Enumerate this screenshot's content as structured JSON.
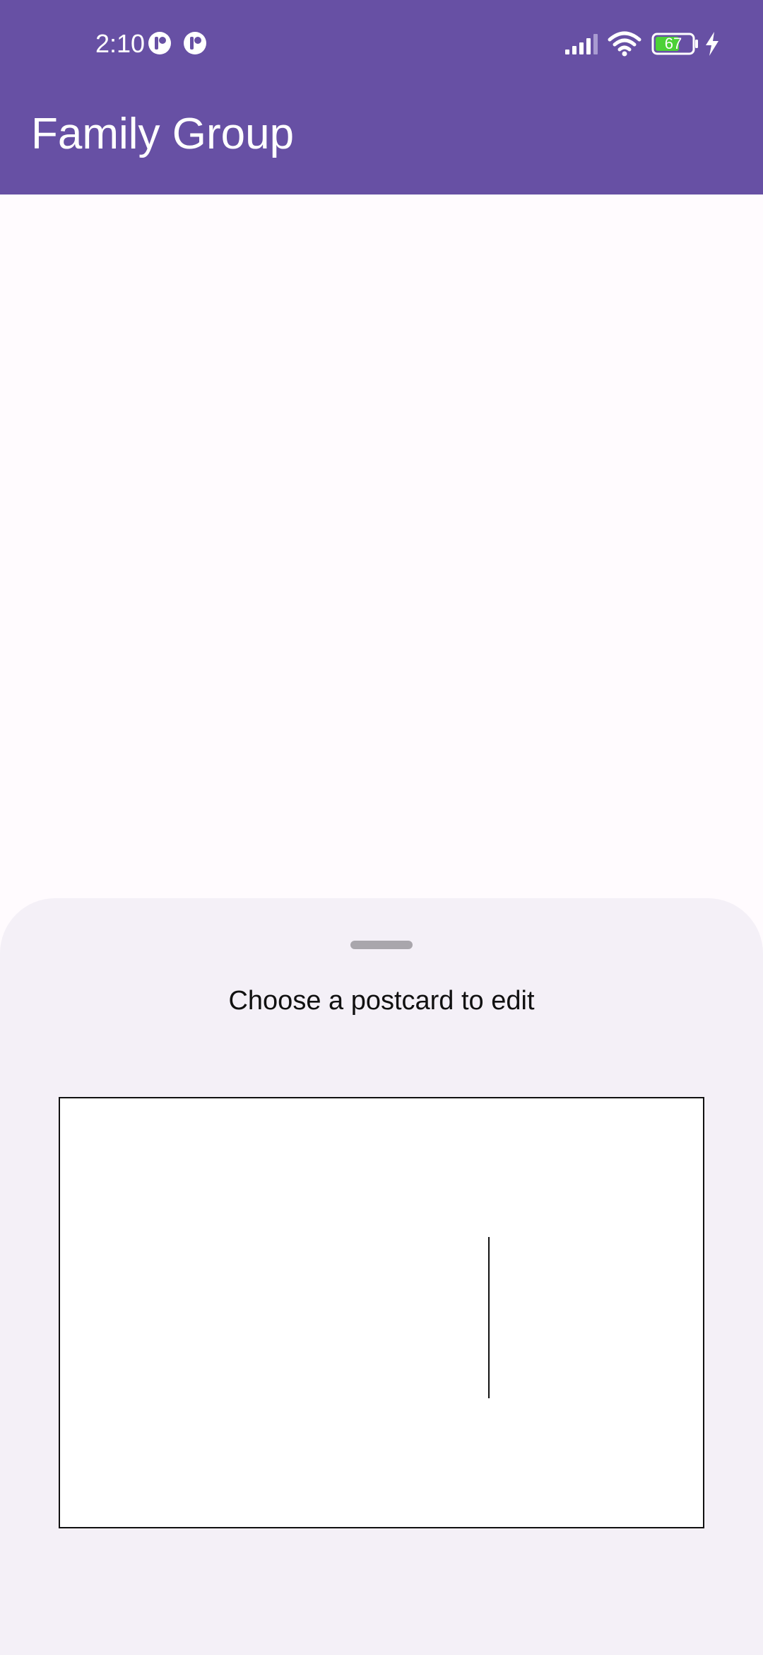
{
  "status_bar": {
    "time": "2:10",
    "battery_level": "67",
    "icons": [
      "notification-icon",
      "notification-icon",
      "signal-icon",
      "wifi-icon",
      "battery-icon",
      "charging-icon"
    ]
  },
  "app_bar": {
    "title": "Family Group"
  },
  "bottom_sheet": {
    "title": "Choose a postcard to edit"
  },
  "colors": {
    "primary": "#6750a4",
    "background": "#fffbfe",
    "sheet_background": "#f4f0f7",
    "battery_fill": "#4cd137"
  }
}
